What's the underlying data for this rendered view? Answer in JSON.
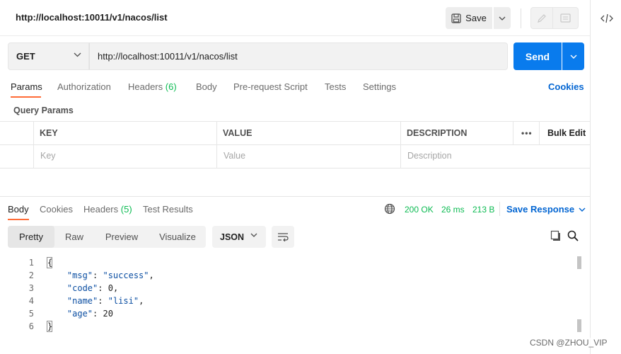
{
  "header": {
    "title": "http://localhost:10011/v1/nacos/list",
    "save_label": "Save"
  },
  "request": {
    "method": "GET",
    "url": "http://localhost:10011/v1/nacos/list",
    "send_label": "Send"
  },
  "request_tabs": [
    {
      "label": "Params",
      "active": true
    },
    {
      "label": "Authorization"
    },
    {
      "label": "Headers",
      "count": "(6)"
    },
    {
      "label": "Body"
    },
    {
      "label": "Pre-request Script"
    },
    {
      "label": "Tests"
    },
    {
      "label": "Settings"
    }
  ],
  "cookies_label": "Cookies",
  "query_params": {
    "title": "Query Params",
    "columns": [
      "KEY",
      "VALUE",
      "DESCRIPTION"
    ],
    "more_label": "•••",
    "bulk_edit": "Bulk Edit",
    "placeholders": {
      "key": "Key",
      "value": "Value",
      "description": "Description"
    }
  },
  "response": {
    "tabs": [
      {
        "label": "Body",
        "active": true
      },
      {
        "label": "Cookies"
      },
      {
        "label": "Headers",
        "count": "(5)"
      },
      {
        "label": "Test Results"
      }
    ],
    "status": "200 OK",
    "time": "26 ms",
    "size": "213 B",
    "save_response": "Save Response",
    "view_modes": [
      "Pretty",
      "Raw",
      "Preview",
      "Visualize"
    ],
    "format": "JSON",
    "lines": [
      {
        "n": "1",
        "text": "{"
      },
      {
        "n": "2",
        "key": "\"msg\"",
        "value": "\"success\"",
        "comma": ","
      },
      {
        "n": "3",
        "key": "\"code\"",
        "value": "0",
        "comma": ","
      },
      {
        "n": "4",
        "key": "\"name\"",
        "value": "\"lisi\"",
        "comma": ","
      },
      {
        "n": "5",
        "key": "\"age\"",
        "value": "20",
        "comma": ""
      },
      {
        "n": "6",
        "text": "}"
      }
    ]
  },
  "watermark": "CSDN @ZHOU_VIP",
  "colors": {
    "accent": "#ff6c37",
    "send": "#097bed",
    "link": "#0265d2",
    "success": "#0cbb52"
  }
}
